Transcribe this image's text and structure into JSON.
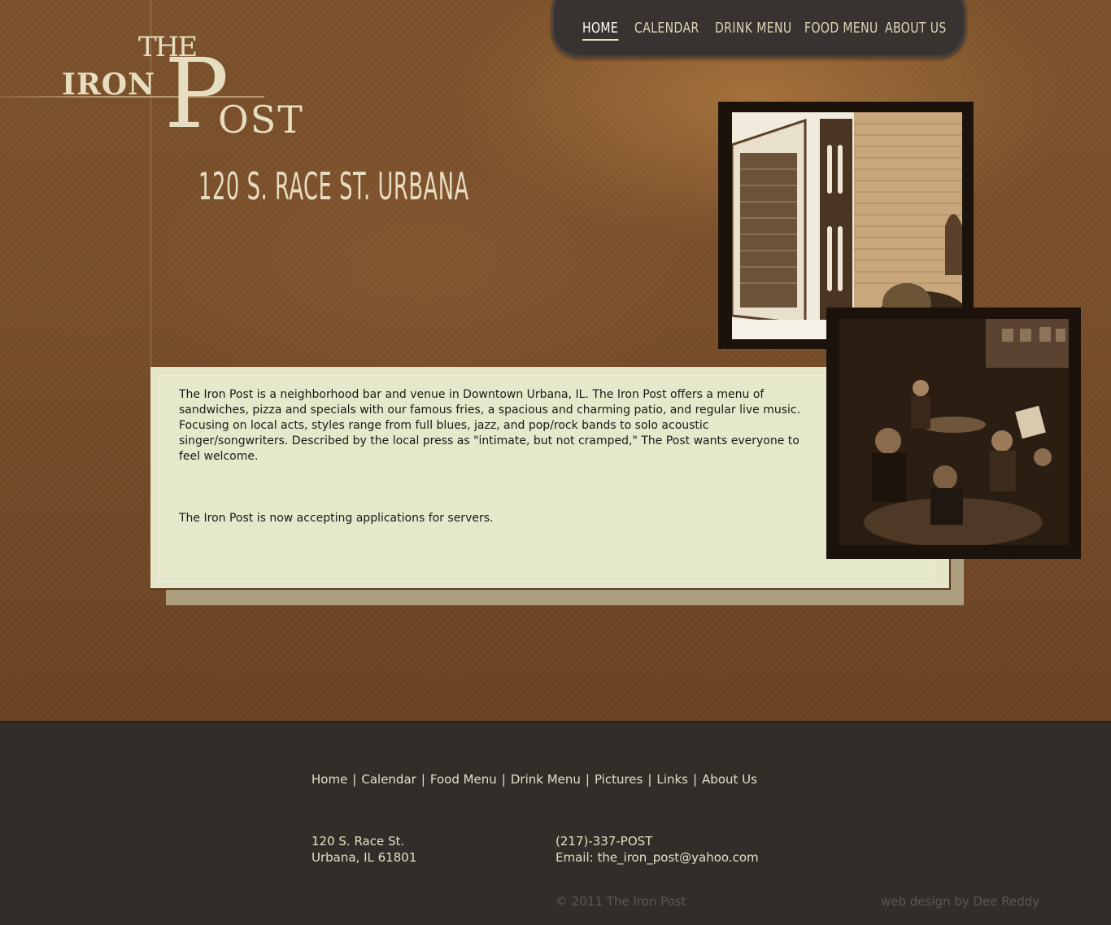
{
  "logo": {
    "the": "THE",
    "iron": "IRON",
    "p": "P",
    "ost": "OST"
  },
  "address_heading": "120 S. RACE ST. URBANA",
  "nav": {
    "items": [
      {
        "label": "HOME",
        "active": true
      },
      {
        "label": "CALENDAR",
        "active": false
      },
      {
        "label": "DRINK MENU",
        "active": false
      },
      {
        "label": "FOOD MENU",
        "active": false
      },
      {
        "label": "ABOUT US",
        "active": false
      }
    ]
  },
  "content": {
    "intro": "The Iron Post is a neighborhood bar and venue in Downtown Urbana, IL. The Iron Post offers a menu of sandwiches, pizza and specials with our famous fries, a spacious and charming patio, and regular live music. Focusing on local acts, styles range from full blues, jazz, and pop/rock bands to solo acoustic singer/songwriters. Described by the local press as \"intimate, but not cramped,\" The Post wants everyone to feel welcome.",
    "notice": "The Iron Post is now accepting applications for servers."
  },
  "footer": {
    "links": [
      "Home",
      "Calendar",
      "Food Menu",
      "Drink Menu",
      "Pictures",
      "Links",
      "About Us"
    ],
    "separator": "|",
    "address_line1": "120 S. Race St.",
    "address_line2": "Urbana, IL 61801",
    "phone": "(217)-337-POST",
    "email": "Email: the_iron_post@yahoo.com",
    "copyright": "© 2011 The Iron Post",
    "credit": "web design by Dee Reddy"
  },
  "colors": {
    "hero_brown": "#7a502c",
    "cream_text": "#e7ddc0",
    "nav_bg": "#383330",
    "panel_bg": "#e5e6c9",
    "footer_bg": "#332d29"
  }
}
